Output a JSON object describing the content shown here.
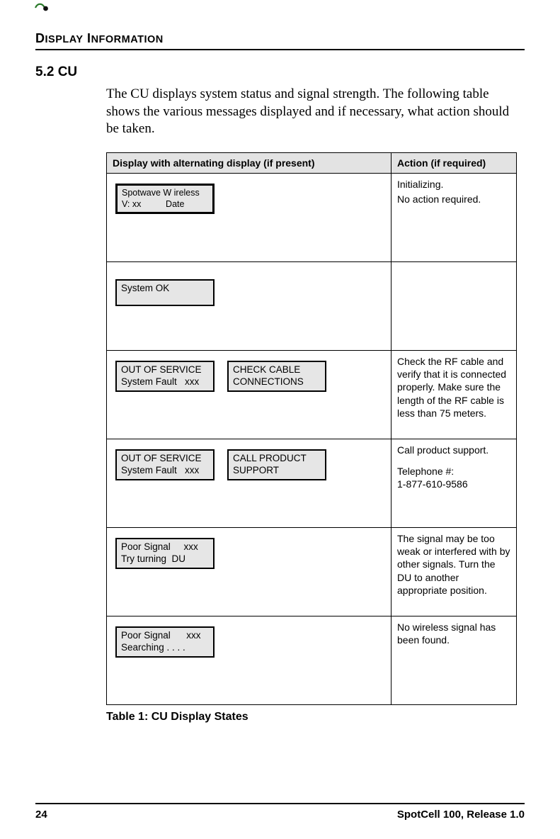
{
  "header": {
    "title": "DISPLAY INFORMATION"
  },
  "section": {
    "number_title": "5.2 CU"
  },
  "intro": "The CU displays system status and signal strength. The following table shows the various messages displayed and if necessary, what action should be taken.",
  "table": {
    "head": {
      "col1": "Display with alternating display (if present)",
      "col2": "Action (if required)"
    },
    "rows": [
      {
        "lcd1": "Spotwave W ireless\nV: xx          Date",
        "lcd2": "",
        "action_l1": "Initializing.",
        "action_l2": "No action required."
      },
      {
        "lcd1": "System OK",
        "lcd2": "",
        "action_l1": "",
        "action_l2": ""
      },
      {
        "lcd1": "OUT OF SERVICE\nSystem Fault   xxx",
        "lcd2": "CHECK CABLE\nCONNECTIONS",
        "action_l1": "Check the RF cable and verify that it is connected properly. Make sure the length of the RF cable is less than 75 meters.",
        "action_l2": ""
      },
      {
        "lcd1": "OUT OF SERVICE\nSystem Fault   xxx",
        "lcd2": "CALL PRODUCT\nSUPPORT",
        "action_l1": "Call product support.",
        "action_l2": "Telephone #:\n1-877-610-9586"
      },
      {
        "lcd1": "Poor Signal     xxx\nTry turning  DU",
        "lcd2": "",
        "action_l1": "The signal may be too weak or interfered with by other signals. Turn the DU to another appropriate position.",
        "action_l2": ""
      },
      {
        "lcd1": "Poor Signal      xxx\nSearching . . . .",
        "lcd2": "",
        "action_l1": "No wireless signal has been found.",
        "action_l2": ""
      }
    ],
    "caption": "Table 1:   CU Display States"
  },
  "footer": {
    "page_number": "24",
    "doc_title": "SpotCell 100, Release 1.0"
  }
}
